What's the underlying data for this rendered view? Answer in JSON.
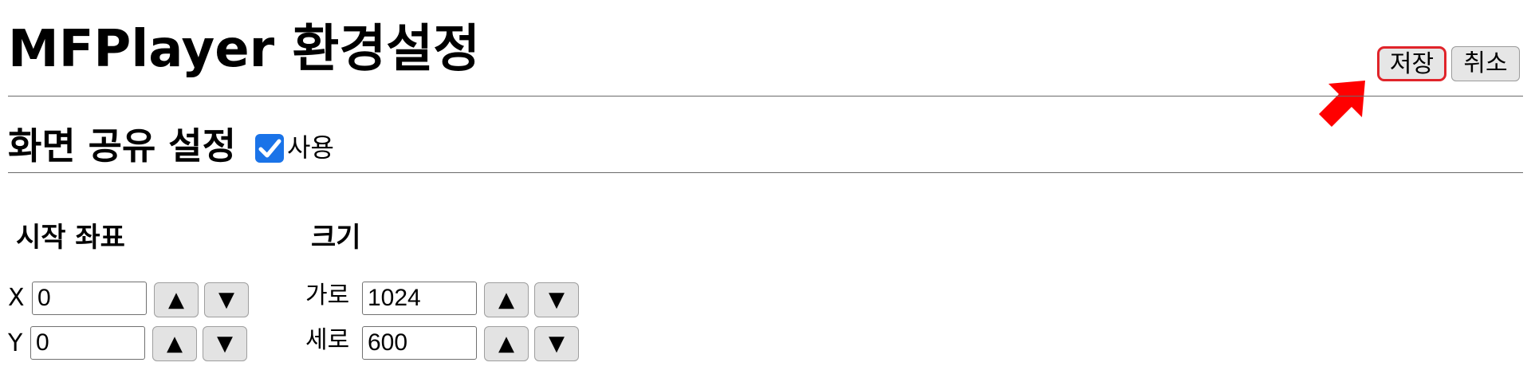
{
  "header": {
    "title": "MFPlayer 환경설정",
    "save_label": "저장",
    "cancel_label": "취소"
  },
  "section": {
    "title": "화면 공유 설정",
    "enable_label": "사용",
    "enabled": true
  },
  "start_coords": {
    "title": "시작 좌표",
    "x_label": "X",
    "x_value": "0",
    "y_label": "Y",
    "y_value": "0"
  },
  "size": {
    "title": "크기",
    "width_label": "가로",
    "width_value": "1024",
    "height_label": "세로",
    "height_value": "600"
  },
  "stepper": {
    "up": "▲",
    "down": "▼"
  },
  "colors": {
    "accent": "#1a73e8",
    "highlight": "#e0242a"
  }
}
